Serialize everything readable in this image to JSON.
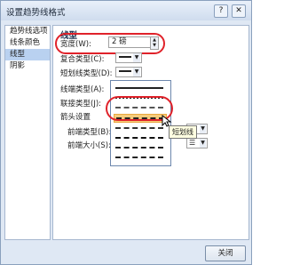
{
  "window": {
    "title": "设置趋势线格式",
    "help_label": "?",
    "close_label": "✕"
  },
  "nav": {
    "items": [
      {
        "label": "趋势线选项",
        "selected": false
      },
      {
        "label": "线条颜色",
        "selected": false
      },
      {
        "label": "线型",
        "selected": true
      },
      {
        "label": "阴影",
        "selected": false
      }
    ]
  },
  "panel": {
    "section_title": "线型",
    "width_label": "宽度(W):",
    "width_value": "2 磅",
    "compound_label": "复合类型(C):",
    "dash_label": "短划线类型(D):",
    "cap_label": "线端类型(A):",
    "join_label": "联接类型(J):",
    "arrow_settings_label": "箭头设置",
    "begin_type_label": "前端类型(B):",
    "begin_size_label": "前端大小(S):"
  },
  "dash_menu": {
    "options": [
      "solid",
      "round-dot",
      "square-dot",
      "dash",
      "dash-dot",
      "long-dash",
      "long-dash-dot",
      "long-dash-dot-dot"
    ],
    "highlighted_index": 3,
    "tooltip": "短划线"
  },
  "footer": {
    "close_label": "关闭"
  },
  "colors": {
    "highlight": "#f6cc7c",
    "annotation": "#e0222a",
    "selection": "#b9d1f0"
  }
}
